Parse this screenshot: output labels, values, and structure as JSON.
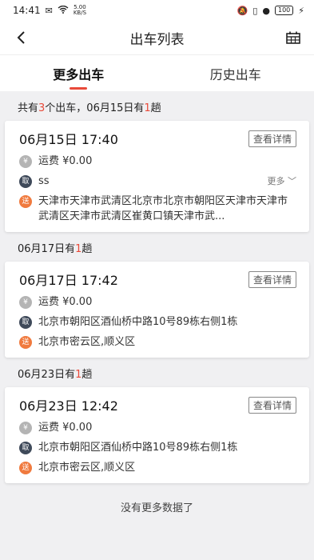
{
  "status_bar": {
    "time": "14:41",
    "net_speed_value": "5.00",
    "net_speed_unit": "KB/S",
    "battery": "100"
  },
  "header": {
    "title": "出车列表"
  },
  "tabs": [
    {
      "label": "更多出车",
      "active": true
    },
    {
      "label": "历史出车",
      "active": false
    }
  ],
  "summary": {
    "prefix": "共有",
    "total": "3",
    "mid": "个出车，06月15日有",
    "count": "1",
    "suffix": "趟"
  },
  "groups": [
    {
      "header": null,
      "card": {
        "datetime": "06月15日 17:40",
        "detail_label": "查看详情",
        "fee_tag": "¥",
        "fee_label": "运费 ¥0.00",
        "take_tag": "取",
        "take_text": "ss",
        "more_label": "更多",
        "send_tag": "送",
        "send_text": "天津市天津市武清区北京市北京市朝阳区天津市天津市武清区天津市武清区崔黄口镇天津市武..."
      }
    },
    {
      "header": {
        "date": "06月17日有",
        "count": "1",
        "suffix": "趟"
      },
      "card": {
        "datetime": "06月17日 17:42",
        "detail_label": "查看详情",
        "fee_tag": "¥",
        "fee_label": "运费 ¥0.00",
        "take_tag": "取",
        "take_text": "北京市朝阳区酒仙桥中路10号89栋右侧1栋",
        "send_tag": "送",
        "send_text": "北京市密云区,顺义区"
      }
    },
    {
      "header": {
        "date": "06月23日有",
        "count": "1",
        "suffix": "趟"
      },
      "card": {
        "datetime": "06月23日 12:42",
        "detail_label": "查看详情",
        "fee_tag": "¥",
        "fee_label": "运费 ¥0.00",
        "take_tag": "取",
        "take_text": "北京市朝阳区酒仙桥中路10号89栋右侧1栋",
        "send_tag": "送",
        "send_text": "北京市密云区,顺义区"
      }
    }
  ],
  "footer": {
    "no_more": "没有更多数据了"
  },
  "colors": {
    "accent": "#e94a3a",
    "take_tag": "#3f4a5a",
    "send_tag": "#f07a3e",
    "fee_tag": "#b4b4b4"
  }
}
